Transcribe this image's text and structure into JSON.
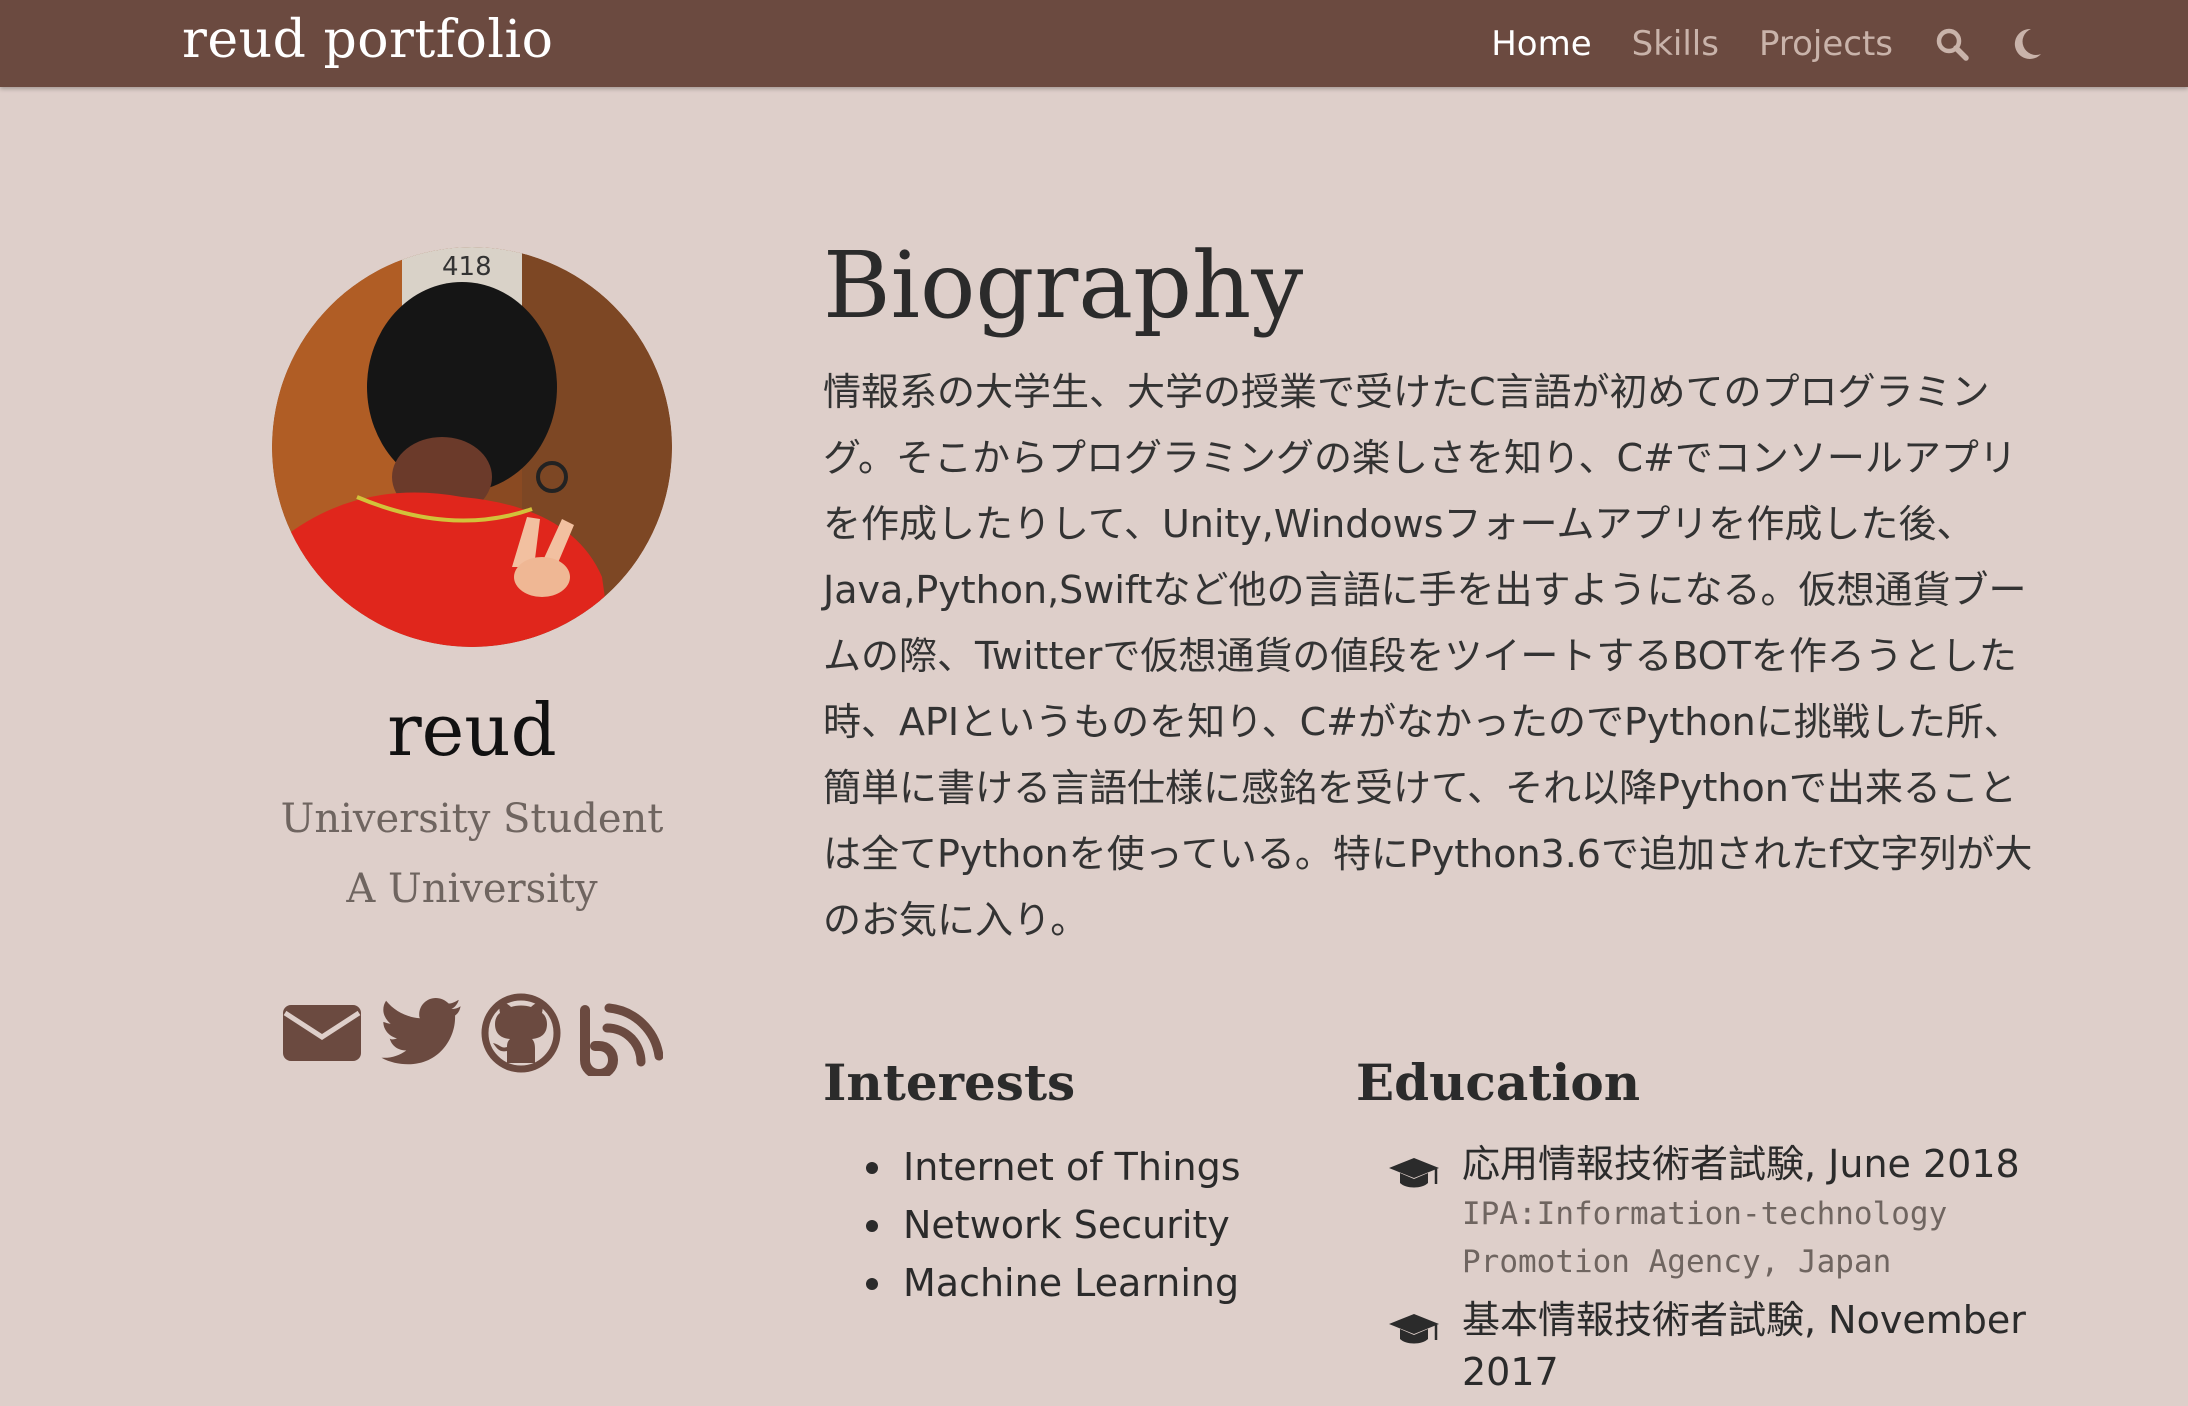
{
  "navbar": {
    "brand": "reud portfolio",
    "links": [
      {
        "label": "Home",
        "active": true
      },
      {
        "label": "Skills",
        "active": false
      },
      {
        "label": "Projects",
        "active": false
      }
    ],
    "icons": [
      "search-icon",
      "moon-icon"
    ]
  },
  "profile": {
    "name": "reud",
    "role": "University Student",
    "organization": "A University",
    "socials": [
      "envelope-icon",
      "twitter-icon",
      "github-icon",
      "blog-icon"
    ]
  },
  "biography": {
    "title": "Biography",
    "text": "情報系の大学生、大学の授業で受けたC言語が初めてのプログラミング。そこからプログラミングの楽しさを知り、C#でコンソールアプリを作成したりして、Unity,Windowsフォームアプリを作成した後、Java,Python,Swiftなど他の言語に手を出すようになる。仮想通貨ブームの際、Twitterで仮想通貨の値段をツイートするBOTを作ろうとした時、APIというものを知り、C#がなかったのでPythonに挑戦した所、簡単に書ける言語仕様に感銘を受けて、それ以降Pythonで出来ることは全てPythonを使っている。特にPython3.6で追加されたf文字列が大のお気に入り。"
  },
  "interests": {
    "title": "Interests",
    "items": [
      "Internet of Things",
      "Network Security",
      "Machine Learning"
    ]
  },
  "education": {
    "title": "Education",
    "items": [
      {
        "course": "応用情報技術者試験, June 2018",
        "institution": "IPA:Information-technology Promotion Agency, Japan"
      },
      {
        "course": "基本情報技術者試験, November 2017",
        "institution": ""
      }
    ]
  },
  "colors": {
    "navbar": "#6b4a40",
    "background": "#decfca",
    "icon": "#6b4a40",
    "muted_text": "#6f6560"
  }
}
